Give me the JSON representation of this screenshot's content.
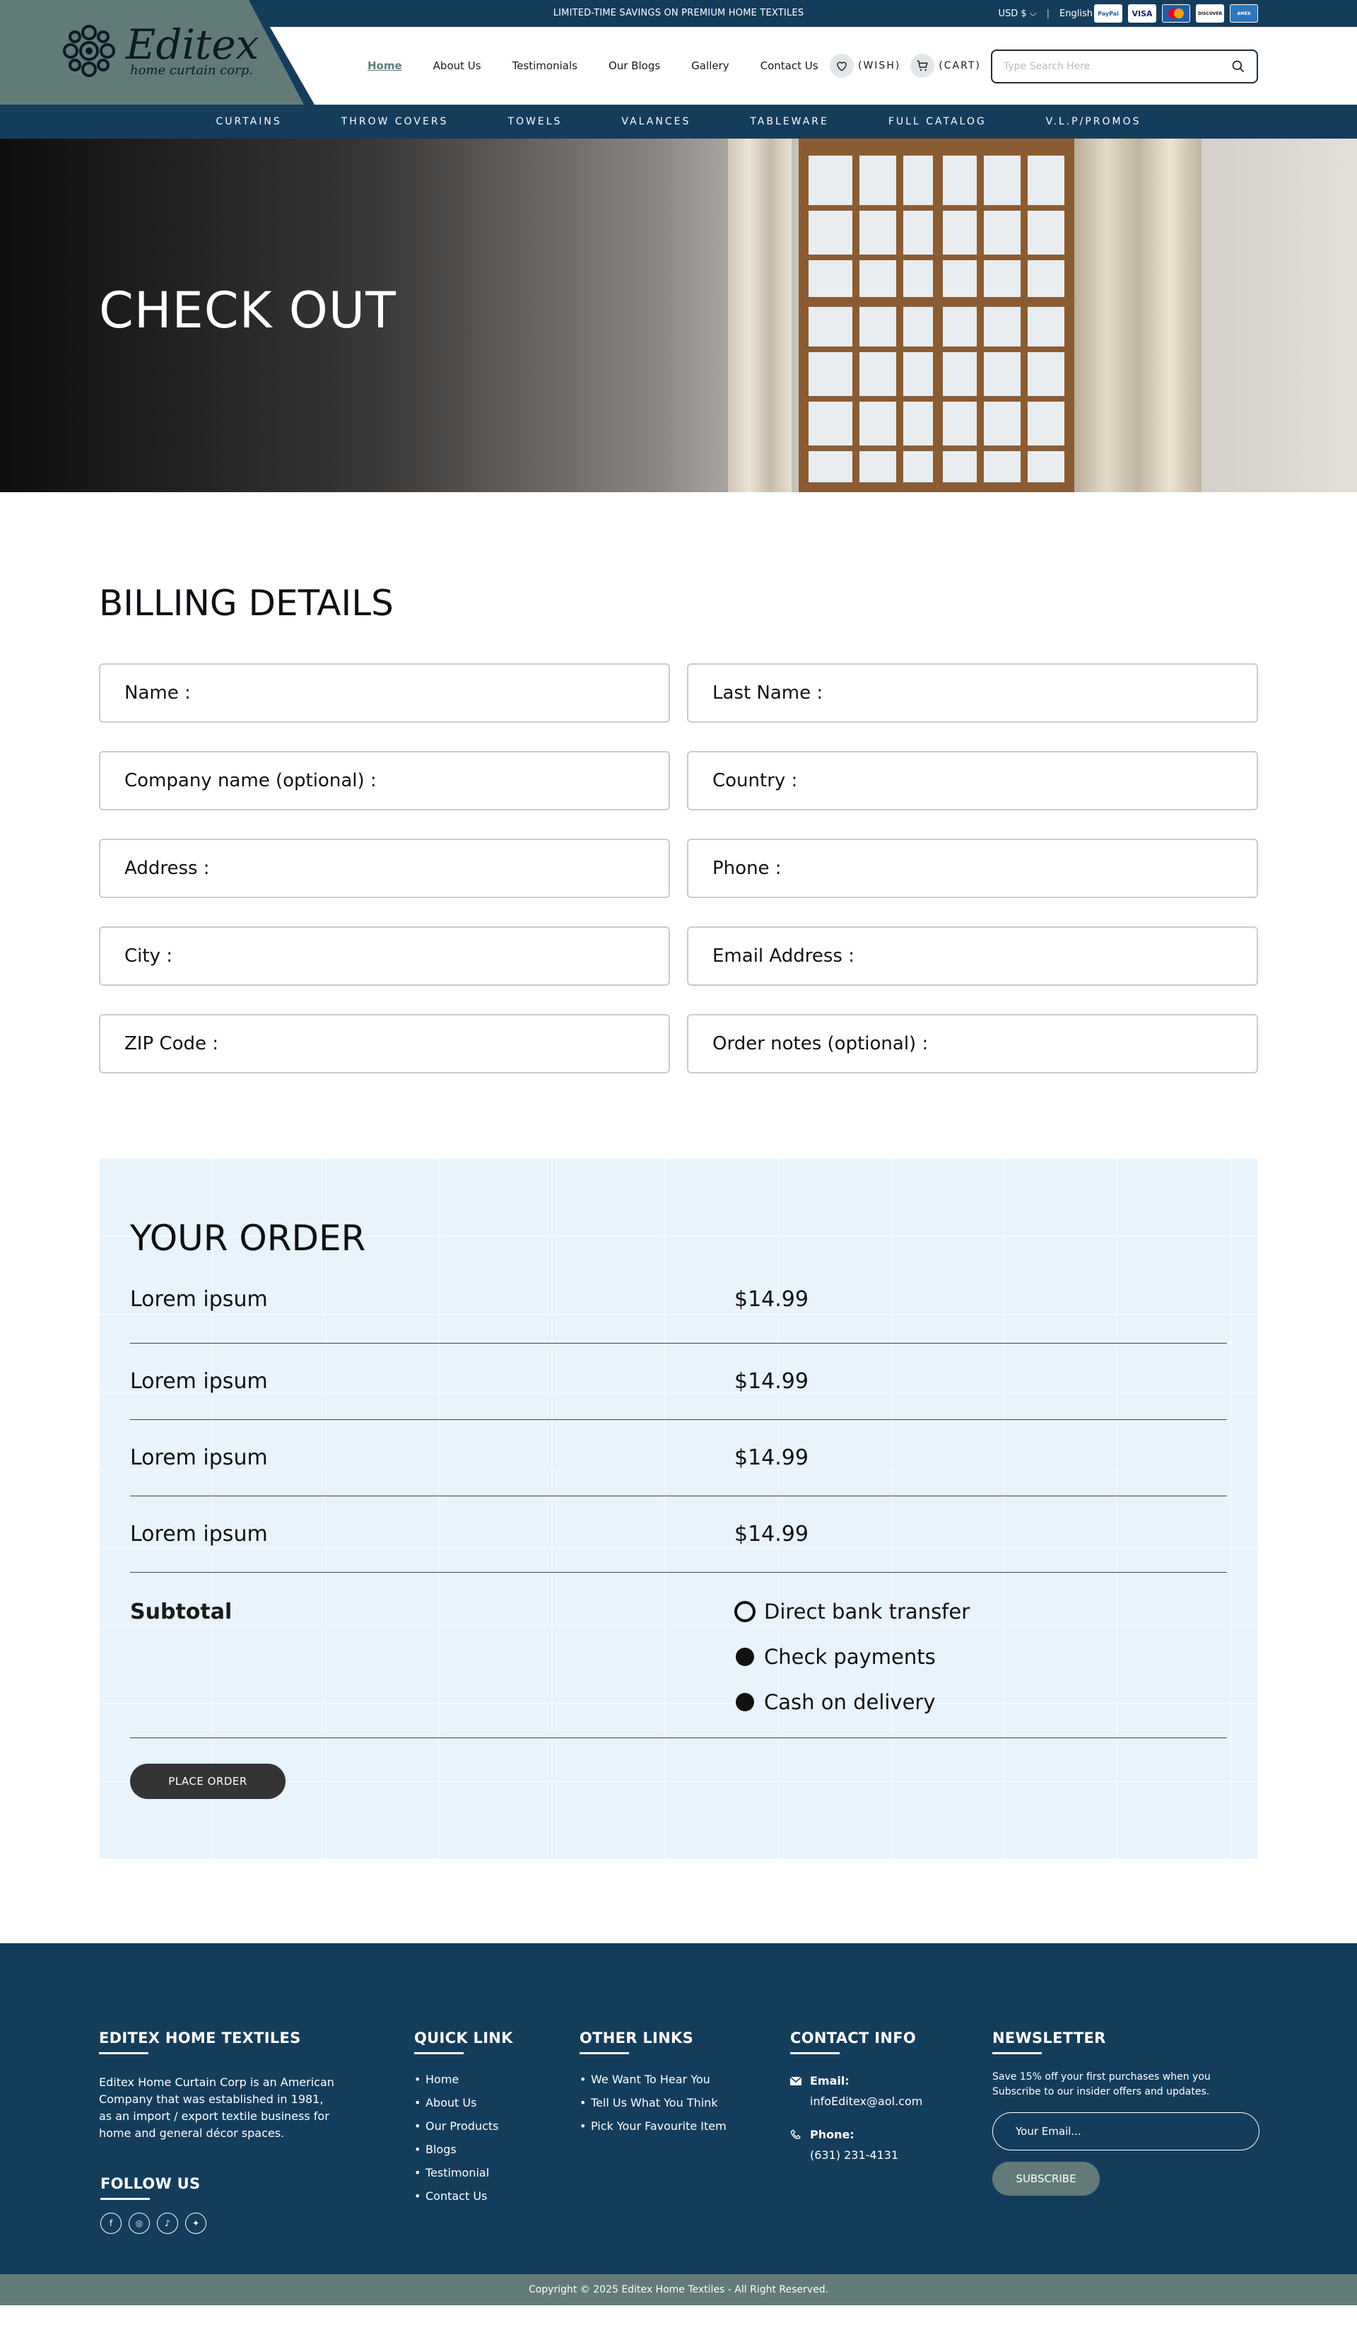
{
  "topbar": {
    "promo": "LIMITED-TIME SAVINGS ON PREMIUM HOME TEXTILES",
    "currency": "USD $",
    "language": "English",
    "payment_methods": [
      "PayPal",
      "VISA",
      "MasterCard",
      "DISCOVER",
      "AMEX"
    ]
  },
  "logo": {
    "name": "Editex",
    "tagline": "home curtain corp."
  },
  "nav": [
    {
      "label": "Home",
      "active": true
    },
    {
      "label": "About Us"
    },
    {
      "label": "Testimonials"
    },
    {
      "label": "Our Blogs"
    },
    {
      "label": "Gallery"
    },
    {
      "label": "Contact Us"
    }
  ],
  "wish_label": "(WISH)",
  "cart_label": "(CART)",
  "search": {
    "placeholder": "Type Search Here"
  },
  "categories": [
    "CURTAINS",
    "THROW COVERS",
    "TOWELS",
    "VALANCES",
    "TABLEWARE",
    "FULL CATALOG",
    "V.L.P/PROMOS"
  ],
  "hero": {
    "title": "CHECK OUT"
  },
  "billing": {
    "title": "BILLING DETAILS",
    "fields": [
      "Name :",
      "Last Name :",
      "Company name (optional) :",
      "Country :",
      "Address :",
      "Phone :",
      "City :",
      "Email Address :",
      "ZIP Code :",
      "Order notes (optional) :"
    ]
  },
  "order": {
    "title": "YOUR ORDER",
    "items": [
      {
        "name": "Lorem ipsum",
        "price": "$14.99"
      },
      {
        "name": "Lorem ipsum",
        "price": "$14.99"
      },
      {
        "name": "Lorem ipsum",
        "price": "$14.99"
      },
      {
        "name": "Lorem ipsum",
        "price": "$14.99"
      }
    ],
    "subtotal_label": "Subtotal",
    "payment_options": [
      {
        "label": "Direct bank transfer",
        "selected": false
      },
      {
        "label": "Check payments",
        "selected": true
      },
      {
        "label": "Cash on delivery",
        "selected": true
      }
    ],
    "place_order": "PLACE ORDER"
  },
  "footer": {
    "about": {
      "title": "EDITEX HOME TEXTILES",
      "text": "Editex Home Curtain Corp is an American Company that was established in 1981, as an import / export textile business for home and general décor spaces."
    },
    "follow": {
      "title": "FOLLOW US",
      "icons": [
        "facebook-icon",
        "instagram-icon",
        "tiktok-icon",
        "twitter-icon"
      ]
    },
    "quick_links": {
      "title": "QUICK LINK",
      "items": [
        "Home",
        "About Us",
        "Our Products",
        "Blogs",
        "Testimonial",
        "Contact Us"
      ]
    },
    "other_links": {
      "title": "OTHER LINKS",
      "items": [
        "We Want To Hear You",
        "Tell Us What You Think",
        "Pick Your Favourite Item"
      ]
    },
    "contact": {
      "title": "CONTACT INFO",
      "email_label": "Email:",
      "email": "infoEditex@aol.com",
      "phone_label": "Phone:",
      "phone": "(631) 231-4131"
    },
    "newsletter": {
      "title": "NEWSLETTER",
      "text": "Save 15% off your first purchases when you Subscribe to our insider offers and updates.",
      "placeholder": "Your Email...",
      "button": "SUBSCRIBE"
    },
    "copyright": "Copyright © 2025 Editex Home Textiles - All Right Reserved."
  },
  "colors": {
    "brand": "#143d5c",
    "accent": "#627b79",
    "active_link": "#5d7f7c",
    "order_bg": "#e8f3fc",
    "button_dark": "#343434"
  }
}
